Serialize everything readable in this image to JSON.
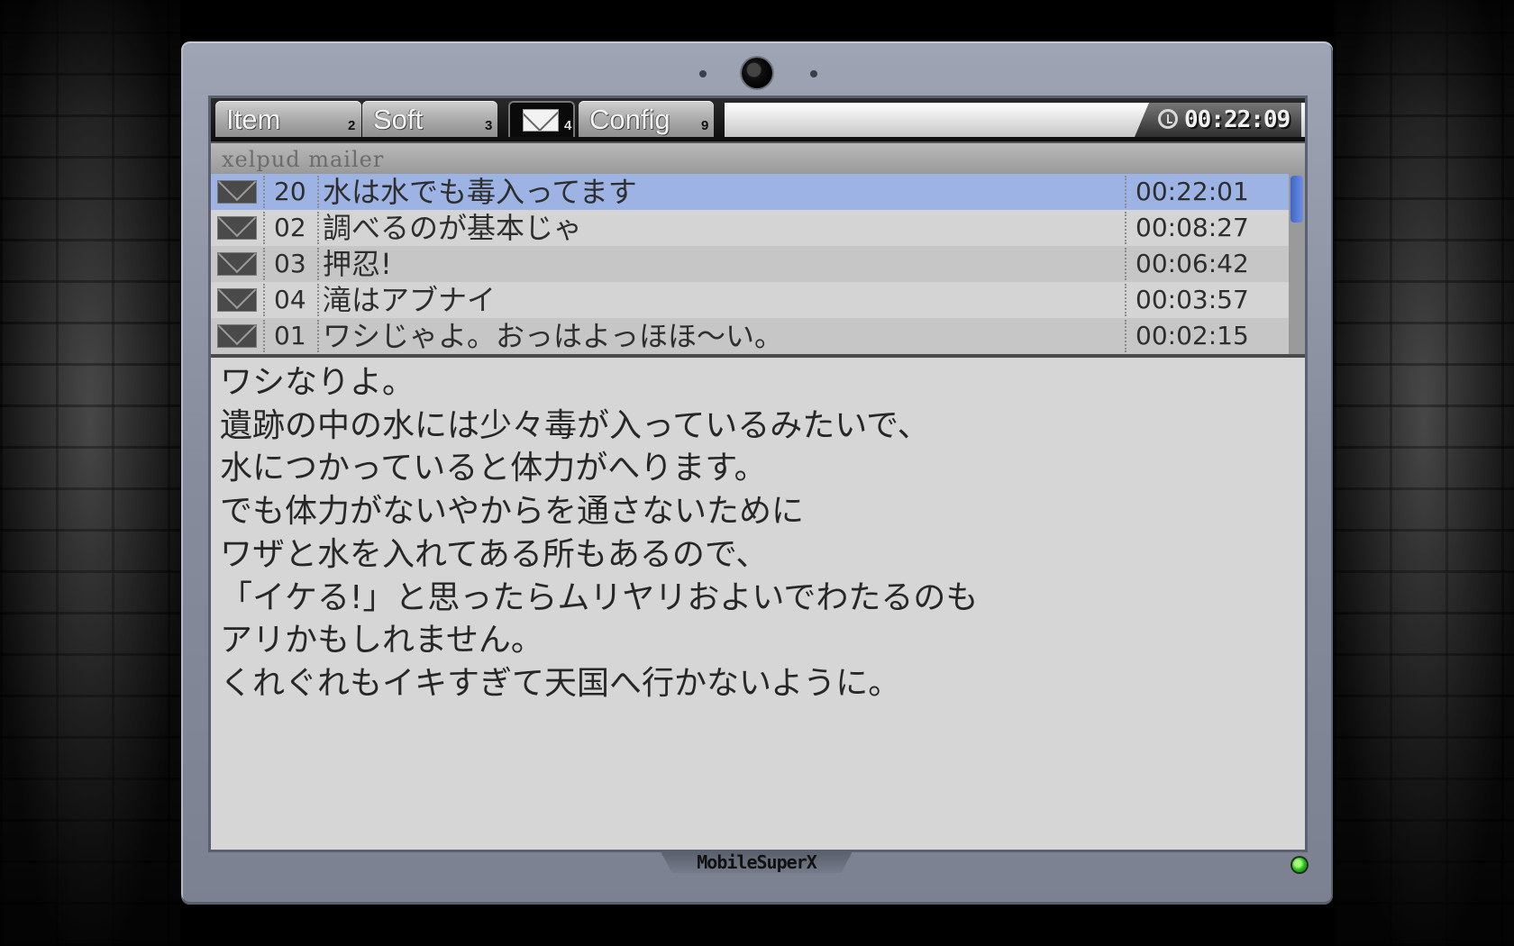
{
  "tabs": [
    {
      "label": "Item",
      "num": "2"
    },
    {
      "label": "Soft",
      "num": "3"
    },
    {
      "label": "",
      "num": "4",
      "icon": "envelope-icon",
      "active": true
    },
    {
      "label": "Config",
      "num": "9"
    }
  ],
  "clock": {
    "time": "00:22:09",
    "icon": "clock-icon"
  },
  "app": {
    "title": "xelpud mailer"
  },
  "mails": [
    {
      "num": "20",
      "subject": "水は水でも毒入ってます",
      "time": "00:22:01",
      "selected": true
    },
    {
      "num": "02",
      "subject": "調べるのが基本じゃ",
      "time": "00:08:27"
    },
    {
      "num": "03",
      "subject": "押忍!",
      "time": "00:06:42"
    },
    {
      "num": "04",
      "subject": "滝はアブナイ",
      "time": "00:03:57"
    },
    {
      "num": "01",
      "subject": "ワシじゃよ。おっはよっほほ〜い。",
      "time": "00:02:15"
    }
  ],
  "body": {
    "lines": [
      "ワシなりよ。",
      "遺跡の中の水には少々毒が入っているみたいで、",
      "水につかっていると体力がへります。",
      "でも体力がないやからを通さないために",
      "ワザと水を入れてある所もあるので、",
      "「イケる!」と思ったらムリヤリおよいでわたるのも",
      "アリかもしれません。",
      "くれぐれもイキすぎて天国へ行かないように。"
    ]
  },
  "device": {
    "brand": "MobileSuperX",
    "led_color": "#2cc11a",
    "selection_color": "#9cb3e4"
  }
}
